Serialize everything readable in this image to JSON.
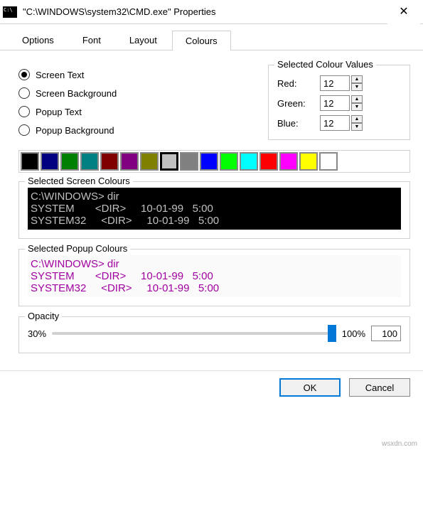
{
  "window": {
    "title": "\"C:\\WINDOWS\\system32\\CMD.exe\" Properties"
  },
  "tabs": {
    "options": "Options",
    "font": "Font",
    "layout": "Layout",
    "colours": "Colours"
  },
  "radios": {
    "screen_text": "Screen Text",
    "screen_bg": "Screen Background",
    "popup_text": "Popup Text",
    "popup_bg": "Popup Background"
  },
  "colour_values": {
    "legend": "Selected Colour Values",
    "red_label": "Red:",
    "red": "12",
    "green_label": "Green:",
    "green": "12",
    "blue_label": "Blue:",
    "blue": "12"
  },
  "swatches": [
    "#000000",
    "#000080",
    "#008000",
    "#008080",
    "#800000",
    "#800080",
    "#808000",
    "#c0c0c0",
    "#808080",
    "#0000ff",
    "#00ff00",
    "#00ffff",
    "#ff0000",
    "#ff00ff",
    "#ffff00",
    "#ffffff"
  ],
  "swatch_selected_index": 7,
  "screen_preview": {
    "legend": "Selected Screen Colours",
    "lines": [
      "C:\\WINDOWS> dir",
      "SYSTEM       <DIR>     10-01-99   5:00",
      "SYSTEM32     <DIR>     10-01-99   5:00"
    ]
  },
  "popup_preview": {
    "legend": "Selected Popup Colours",
    "lines": [
      "C:\\WINDOWS> dir",
      "SYSTEM       <DIR>     10-01-99   5:00",
      "SYSTEM32     <DIR>     10-01-99   5:00"
    ]
  },
  "opacity": {
    "legend": "Opacity",
    "min": "30%",
    "max": "100%",
    "value": "100"
  },
  "buttons": {
    "ok": "OK",
    "cancel": "Cancel"
  },
  "watermark": "wsxdn.com"
}
